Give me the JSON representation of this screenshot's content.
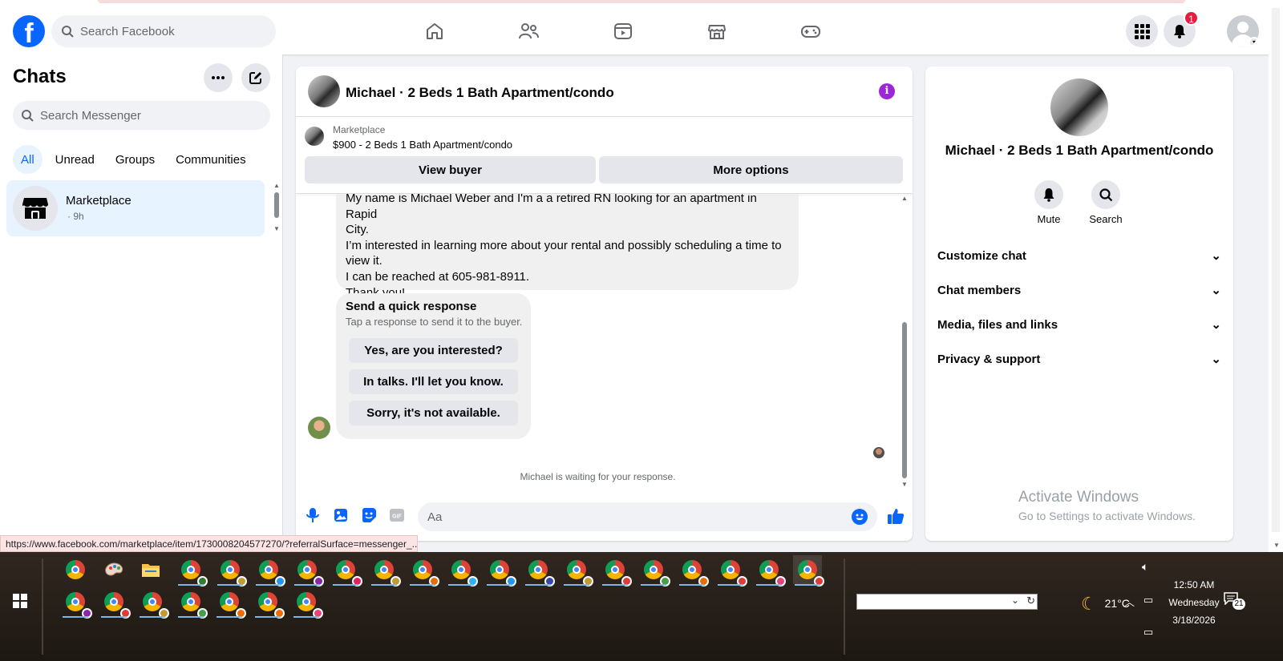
{
  "search_facebook": {
    "placeholder": "Search Facebook"
  },
  "nav": {
    "items": [
      "home-icon",
      "friends-icon",
      "video-icon",
      "marketplace-icon",
      "gaming-icon"
    ]
  },
  "topbar_right": {
    "notifications_count": "1"
  },
  "chats": {
    "title": "Chats",
    "search_placeholder": "Search Messenger",
    "filters": [
      "All",
      "Unread",
      "Groups",
      "Communities"
    ],
    "active_filter": "All",
    "items": [
      {
        "name": "Marketplace",
        "time": "· 9h"
      }
    ]
  },
  "conversation": {
    "title": "Michael · 2 Beds 1 Bath Apartment/condo",
    "marketplace_label": "Marketplace",
    "listing": "$900 - 2 Beds 1 Bath Apartment/condo",
    "view_buyer": "View buyer",
    "more_options": "More options",
    "message_lines": [
      "My name is Michael Weber and I'm a a retired RN looking for an apartment in Rapid",
      "City.",
      "I’m interested in learning more about your rental and possibly scheduling a time to",
      "view it.",
      "I can be reached at 605-981-8911.",
      "Thank you!"
    ],
    "quick_response": {
      "title": "Send a quick response",
      "subtitle": "Tap a response to send it to the buyer.",
      "options": [
        "Yes, are you interested?",
        "In talks. I'll let you know.",
        "Sorry, it's not available."
      ]
    },
    "waiting": "Michael is waiting for your response.",
    "composer_placeholder": "Aa"
  },
  "details": {
    "title": "Michael · 2 Beds 1 Bath Apartment/condo",
    "mute": "Mute",
    "search": "Search",
    "sections": [
      "Customize chat",
      "Chat members",
      "Media, files and links",
      "Privacy & support"
    ]
  },
  "watermark": {
    "line1": "Activate Windows",
    "line2": "Go to Settings to activate Windows."
  },
  "status_url": "https://www.facebook.com/marketplace/item/1730008204577270/?referralSurface=messenger_...",
  "taskbar": {
    "weather": "21°C",
    "time": "12:50 AM",
    "day": "Wednesday",
    "date": "3/18/2026",
    "notification_count": "21"
  },
  "colors": {
    "brand": "#0866ff",
    "badge": "#e41e3f",
    "info": "#9b27d9"
  }
}
